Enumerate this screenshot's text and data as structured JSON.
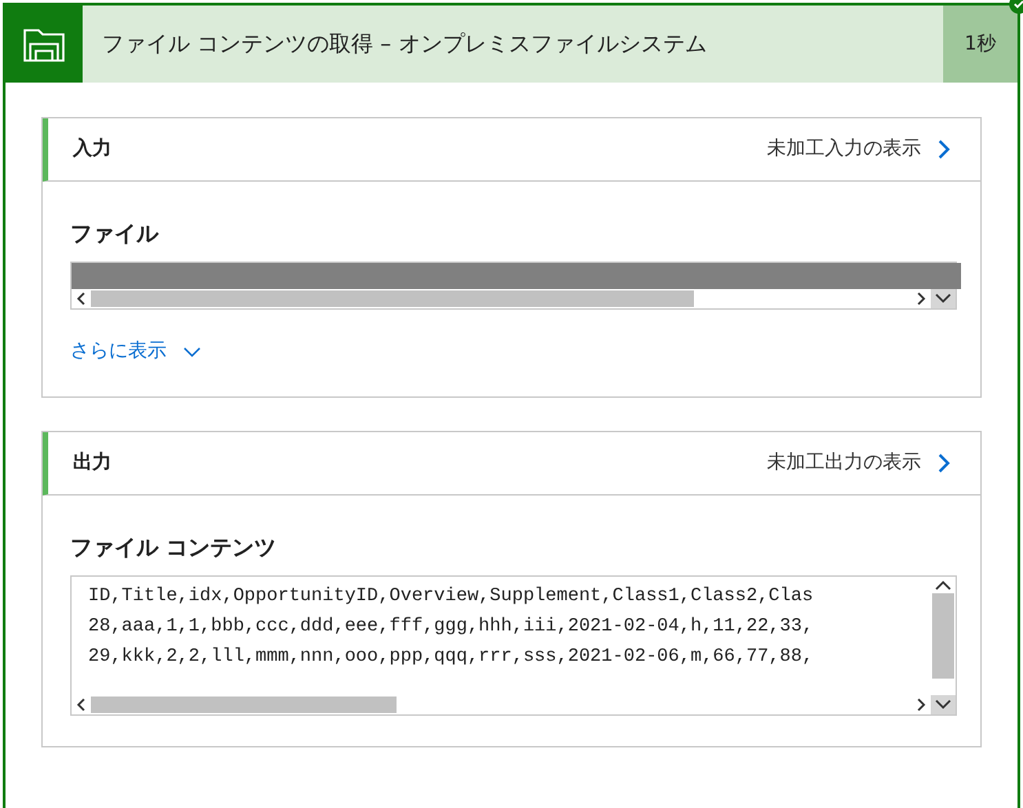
{
  "header": {
    "title": "ファイル コンテンツの取得 – オンプレミスファイルシステム",
    "duration": "1秒"
  },
  "sections": [
    {
      "kind": "redacted",
      "heading": "入力",
      "raw_link": "未加工入力の表示",
      "field_label": "ファイル",
      "show_more": "さらに表示"
    },
    {
      "kind": "text",
      "heading": "出力",
      "raw_link": "未加工出力の表示",
      "field_label": "ファイル コンテンツ",
      "lines": [
        "ID,Title,idx,OpportunityID,Overview,Supplement,Class1,Class2,Clas",
        "28,aaa,1,1,bbb,ccc,ddd,eee,fff,ggg,hhh,iii,2021-02-04,h,11,22,33,",
        "29,kkk,2,2,lll,mmm,nnn,ooo,ppp,qqq,rrr,sss,2021-02-06,m,66,77,88,"
      ]
    }
  ]
}
